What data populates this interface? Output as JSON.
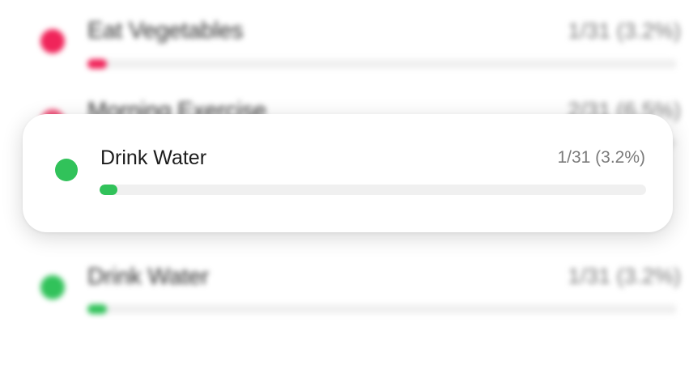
{
  "colors": {
    "pink": "#f0245a",
    "green": "#31c25a"
  },
  "background_list": [
    {
      "title": "Eat Vegetables",
      "stat": "1/31 (3.2%)",
      "color": "#f0245a",
      "progress": 0.032
    },
    {
      "title": "Morning Exercise",
      "stat": "2/31 (6.5%)",
      "color": "#f3517a",
      "progress": 0.065
    },
    {
      "title": "Drink Water",
      "stat": "1/31 (3.2%)",
      "color": "#31c25a",
      "progress": 0.032
    }
  ],
  "card": {
    "title": "Drink Water",
    "stat": "1/31 (3.2%)",
    "color": "#31c25a",
    "icon": "status-dot-icon",
    "progress": 0.032
  }
}
